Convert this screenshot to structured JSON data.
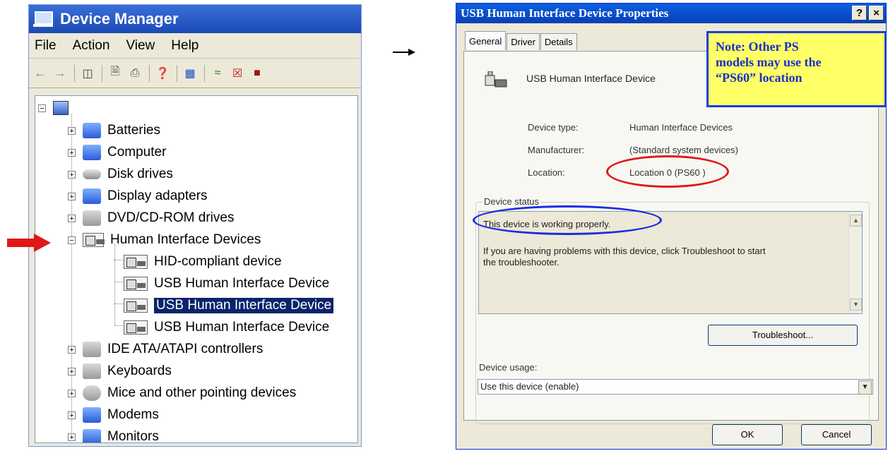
{
  "device_manager": {
    "title": "Device Manager",
    "menu": [
      "File",
      "Action",
      "View",
      "Help"
    ],
    "tree": [
      {
        "label": "Batteries",
        "expander": "+",
        "icon": "battery-icon"
      },
      {
        "label": "Computer",
        "expander": "+",
        "icon": "computer-icon"
      },
      {
        "label": "Disk drives",
        "expander": "+",
        "icon": "disk-drive-icon"
      },
      {
        "label": "Display adapters",
        "expander": "+",
        "icon": "display-adapter-icon"
      },
      {
        "label": "DVD/CD-ROM drives",
        "expander": "+",
        "icon": "dvd-drive-icon"
      },
      {
        "label": "Human Interface Devices",
        "expander": "−",
        "icon": "hid-icon"
      },
      {
        "label": "HID-compliant device",
        "icon": "hid-icon"
      },
      {
        "label": "USB Human Interface Device",
        "icon": "hid-icon"
      },
      {
        "label": "USB Human Interface Device",
        "icon": "hid-icon",
        "selected": true
      },
      {
        "label": "USB Human Interface Device",
        "icon": "hid-icon"
      },
      {
        "label": "IDE ATA/ATAPI controllers",
        "expander": "+",
        "icon": "ide-controller-icon"
      },
      {
        "label": "Keyboards",
        "expander": "+",
        "icon": "keyboard-icon"
      },
      {
        "label": "Mice and other pointing devices",
        "expander": "+",
        "icon": "mouse-icon"
      },
      {
        "label": "Modems",
        "expander": "+",
        "icon": "modem-icon"
      },
      {
        "label": "Monitors",
        "expander": "+",
        "icon": "monitor-icon"
      }
    ]
  },
  "properties": {
    "title": "USB Human Interface Device Properties",
    "help_btn": "?",
    "close_btn": "×",
    "tabs": [
      "General",
      "Driver",
      "Details"
    ],
    "device_name": "USB Human Interface Device",
    "device_type_label": "Device type:",
    "device_type_value": "Human Interface Devices",
    "manufacturer_label": "Manufacturer:",
    "manufacturer_value": "(Standard system devices)",
    "location_label": "Location:",
    "location_value": "Location 0 (PS60 )",
    "status_legend": "Device status",
    "status_line1": "This device is working properly.",
    "status_line2": "If you are having problems with this device, click Troubleshoot to start",
    "status_line3": "the troubleshooter.",
    "troubleshoot": "Troubleshoot...",
    "usage_label": "Device usage:",
    "usage_value": "Use this device (enable)",
    "ok": "OK",
    "cancel": "Cancel"
  },
  "note": {
    "line1": "Note: Other PS",
    "line2": "models may use the",
    "line3": "“PS60” location"
  },
  "colors": {
    "note_bg": "#ffff66",
    "note_text": "#1a30c8",
    "red_annotation": "#e01818",
    "blue_annotation": "#1a2ee0"
  }
}
